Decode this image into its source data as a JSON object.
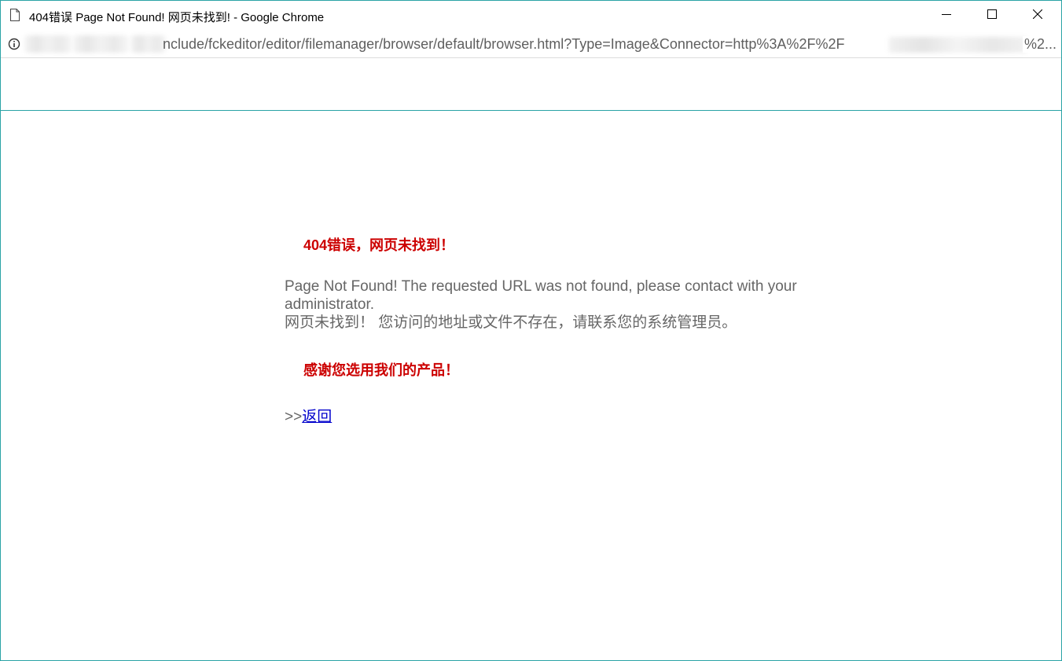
{
  "window": {
    "title": "404错误 Page Not Found! 网页未找到! - Google Chrome",
    "page_icon": "page-icon",
    "controls": {
      "minimize": "minimize-icon",
      "maximize": "maximize-icon",
      "close": "close-icon"
    }
  },
  "addressbar": {
    "info_icon": "info-icon",
    "url_visible": "nclude/fckeditor/editor/filemanager/browser/default/browser.html?Type=Image&Connector=http%3A%2F%2F",
    "url_tail": "%2..."
  },
  "page": {
    "heading": "404错误，网页未找到！",
    "message_en": "Page Not Found! The requested URL was not found, please contact with your administrator.",
    "message_cn": "网页未找到！  您访问的地址或文件不存在，请联系您的系统管理员。",
    "thanks": "感谢您选用我们的产品！",
    "back_prefix": ">>",
    "back_link": "返回"
  },
  "colors": {
    "window_border": "#2aa3a6",
    "heading_red": "#cc0000",
    "body_text": "#666666",
    "link": "#0000cc"
  }
}
